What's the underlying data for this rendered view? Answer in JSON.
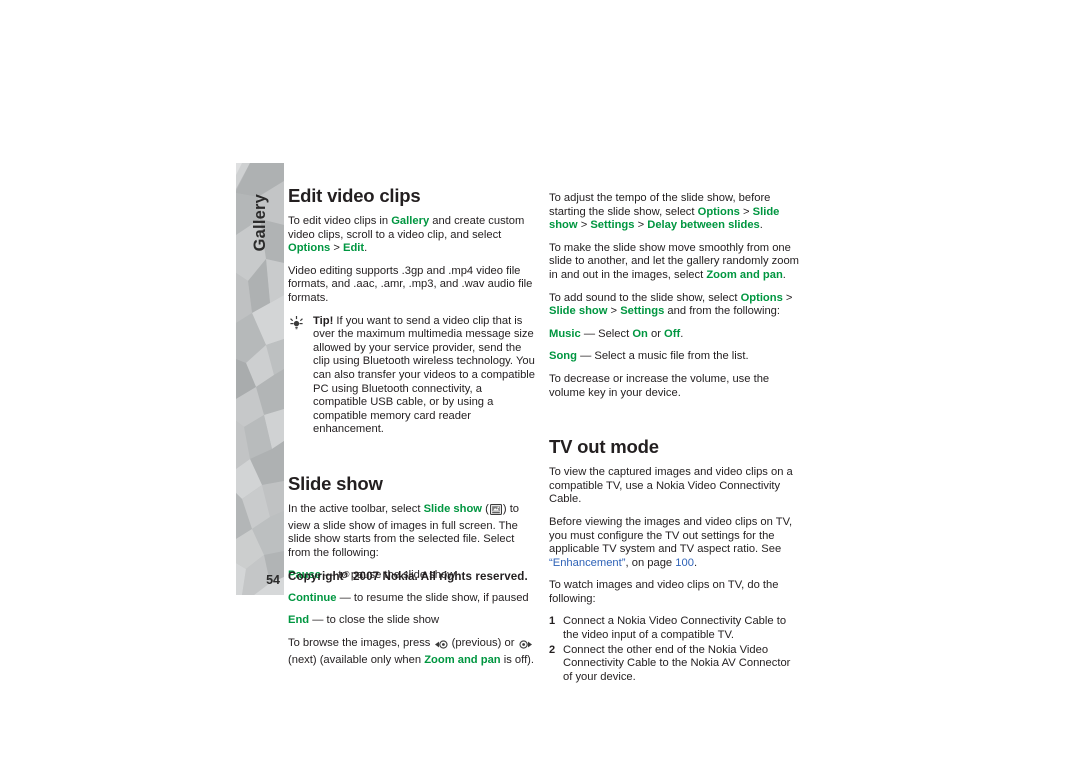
{
  "document": {
    "sidebar_tab_label": "Gallery",
    "page_number": "54",
    "footer": {
      "prefix": "Copyright",
      "mark": "©",
      "suffix": " 2007 Nokia. All rights reserved."
    }
  },
  "left_column": {
    "heading_1": "Edit video clips",
    "p1": {
      "a": "To edit video clips in ",
      "b_green": "Gallery",
      "c": " and create custom video clips, scroll to a video clip, and select ",
      "d_green": "Options",
      "e": " > ",
      "f_green": "Edit",
      "g": "."
    },
    "p2": "Video editing supports .3gp and .mp4 video file formats, and .aac, .amr, .mp3, and .wav audio file formats.",
    "tip": {
      "icon": "tip-bulb-icon",
      "label": "Tip!",
      "text": " If you want to send a video clip that is over the maximum multimedia message size allowed by your service provider, send the clip using Bluetooth wireless technology. You can also transfer your videos to a compatible PC using Bluetooth connectivity, a compatible USB cable, or by using a compatible memory card reader enhancement."
    },
    "heading_2": "Slide show",
    "p3": {
      "a": "In the active toolbar, select ",
      "b_green": "Slide show",
      "c": " (",
      "icon": "slideshow-toolbar-icon",
      "d": ") to view a slide show of images in full screen. The slide show starts from the selected file. Select from the following:"
    },
    "items": [
      {
        "term_green": "Pause",
        "dash": " — ",
        "desc": "to pause the slide show"
      },
      {
        "term_green": "Continue",
        "dash": " — ",
        "desc": "to resume the slide show, if paused"
      },
      {
        "term_green": "End",
        "dash": " — ",
        "desc": "to close the slide show"
      }
    ],
    "p4": {
      "a": "To browse the images, press ",
      "icon_prev": "scroll-left-key-icon",
      "b": " (previous) or ",
      "icon_next": "scroll-right-key-icon",
      "c": " (next) (available only when ",
      "d_green": "Zoom and pan",
      "e": " is off)."
    }
  },
  "right_column": {
    "p1": {
      "a": "To adjust the tempo of the slide show, before starting the slide show, select ",
      "b_green": "Options",
      "c": " > ",
      "d_green": "Slide show",
      "e": " > ",
      "f_green": "Settings",
      "g": " > ",
      "h_green": "Delay between slides",
      "i": "."
    },
    "p2": {
      "a": "To make the slide show move smoothly from one slide to another, and let the gallery randomly zoom in and out in the images, select ",
      "b_green": "Zoom and pan",
      "c": "."
    },
    "p3": {
      "a": "To add sound to the slide show, select ",
      "b_green": "Options",
      "c": " > ",
      "d_green": "Slide show",
      "e": " > ",
      "f_green": "Settings",
      "g": " and from the following:"
    },
    "items": [
      {
        "term_green": "Music",
        "dash": " — ",
        "pre": "Select ",
        "v1_green": "On",
        "mid": " or ",
        "v2_green": "Off",
        "post": "."
      },
      {
        "term_green": "Song",
        "dash": " — ",
        "pre": "Select a music file from the list.",
        "v1_green": "",
        "mid": "",
        "v2_green": "",
        "post": ""
      }
    ],
    "p4": "To decrease or increase the volume, use the volume key in your device.",
    "heading_1": "TV out mode",
    "p5": "To view the captured images and video clips on a compatible TV, use a Nokia Video Connectivity Cable.",
    "p6": {
      "a": "Before viewing the images and video clips on TV, you must configure the TV out settings for the applicable TV system and TV aspect ratio. See ",
      "link": "“Enhancement”",
      "b": ", on page ",
      "page_link": "100",
      "c": "."
    },
    "p7": "To watch images and video clips on TV, do the following:",
    "steps": [
      {
        "num": "1",
        "text": "Connect a Nokia Video Connectivity Cable to the video input of a compatible TV."
      },
      {
        "num": "2",
        "text": "Connect the other end of the Nokia Video Connectivity Cable to the Nokia AV Connector of your device."
      }
    ]
  },
  "colors": {
    "green": "#009640",
    "link_blue": "#2e62b7",
    "text": "#231f20",
    "sidebar_base": "#b9bbbc"
  }
}
